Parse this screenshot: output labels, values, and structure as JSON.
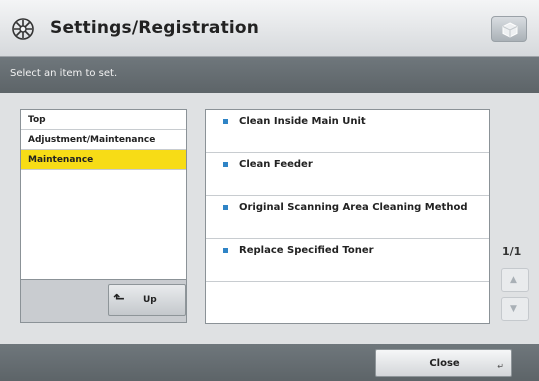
{
  "header": {
    "title": "Settings/Registration",
    "icon": "settings-gear-icon",
    "right_button_icon": "cube-icon"
  },
  "instruction": "Select an item to set.",
  "breadcrumbs": [
    {
      "label": "Top",
      "active": false
    },
    {
      "label": "Adjustment/Maintenance",
      "active": false
    },
    {
      "label": "Maintenance",
      "active": true
    }
  ],
  "up_button": {
    "label": "Up",
    "icon": "return-arrow-icon"
  },
  "items": [
    {
      "label": "Clean Inside Main Unit"
    },
    {
      "label": "Clean Feeder"
    },
    {
      "label": "Original Scanning Area Cleaning Method"
    },
    {
      "label": "Replace Specified Toner"
    }
  ],
  "pager": {
    "text": "1/1",
    "up_icon": "scroll-up-icon",
    "down_icon": "scroll-down-icon"
  },
  "footer": {
    "close_label": "Close"
  },
  "colors": {
    "accent": "#f7dc16",
    "bullet": "#2f84c6",
    "bar": "#656c71"
  }
}
